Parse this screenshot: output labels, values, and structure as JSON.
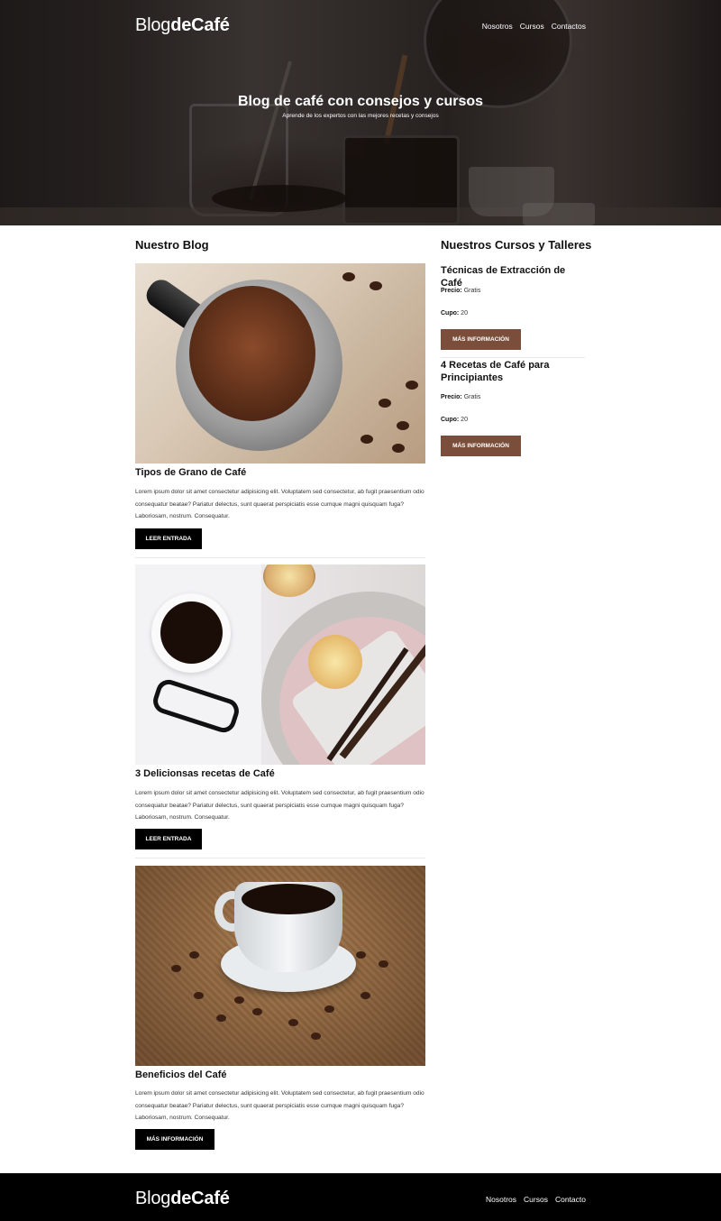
{
  "header": {
    "logo_light": "Blog",
    "logo_bold": "deCafé",
    "nav": [
      "Nosotros",
      "Cursos",
      "Contactos"
    ]
  },
  "hero": {
    "title": "Blog de café con consejos y cursos",
    "subtitle": "Aprende de los expertos con las mejores recetas y consejos"
  },
  "blog": {
    "heading": "Nuestro Blog",
    "posts": [
      {
        "title": "Tipos de Grano de Café",
        "text": "Lorem ipsum dolor sit amet consectetur adipisicing elit. Voluptatem sed consectetur, ab fugit praesentium odio consequatur beatae? Pariatur delectus, sunt quaerat perspiciatis esse cumque magni quisquam fuga? Laboriosam, nostrum. Consequatur.",
        "button": "Leer Entrada"
      },
      {
        "title": "3 Delicionsas recetas de Café",
        "text": "Lorem ipsum dolor sit amet consectetur adipisicing elit. Voluptatem sed consectetur, ab fugit praesentium odio consequatur beatae? Pariatur delectus, sunt quaerat perspiciatis esse cumque magni quisquam fuga? Laboriosam, nostrum. Consequatur.",
        "button": "Leer Entrada"
      },
      {
        "title": "Beneficios del Café",
        "text": "Lorem ipsum dolor sit amet consectetur adipisicing elit. Voluptatem sed consectetur, ab fugit praesentium odio consequatur beatae? Pariatur delectus, sunt quaerat perspiciatis esse cumque magni quisquam fuga? Laboriosam, nostrum. Consequatur.",
        "button": "Más Información"
      }
    ]
  },
  "courses": {
    "heading": "Nuestros Cursos y Talleres",
    "price_label": "Precio:",
    "seats_label": "Cupo:",
    "items": [
      {
        "title": "Técnicas de Extracción de Café",
        "price": "Gratis",
        "seats": "20",
        "button": "MÁS INFORMACIÓN"
      },
      {
        "title": "4 Recetas de Café para Principiantes",
        "price": "Gratis",
        "seats": "20",
        "button": "MÁS INFORMACIÓN"
      }
    ]
  },
  "footer": {
    "logo_light": "Blog",
    "logo_bold": "deCafé",
    "nav": [
      "Nosotros",
      "Cursos",
      "Contacto"
    ]
  },
  "colors": {
    "accent_brown": "#7a4e3a",
    "button_black": "#000000",
    "footer_bg": "#000000"
  }
}
